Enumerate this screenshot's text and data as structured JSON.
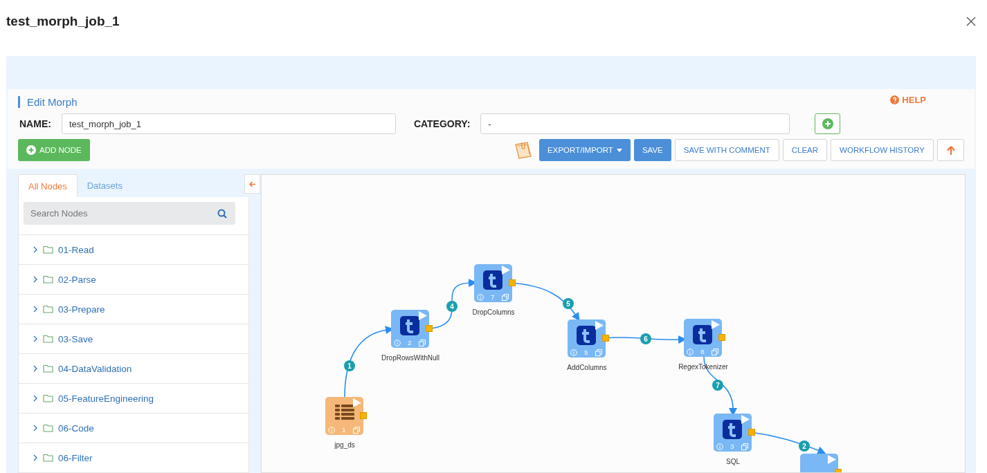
{
  "window": {
    "title": "test_morph_job_1"
  },
  "editor": {
    "heading": "Edit Morph",
    "help": "HELP",
    "name_label": "NAME:",
    "name_value": "test_morph_job_1",
    "category_label": "CATEGORY:",
    "category_value": "-",
    "add_node": "ADD NODE",
    "actions": [
      {
        "label": "EXPORT/IMPORT",
        "kind": "dropdown"
      },
      {
        "label": "SAVE",
        "kind": "primary"
      },
      {
        "label": "SAVE WITH COMMENT",
        "kind": "plain"
      },
      {
        "label": "CLEAR",
        "kind": "plain"
      },
      {
        "label": "WORKFLOW HISTORY",
        "kind": "plain"
      }
    ]
  },
  "sidebar": {
    "tabs": [
      {
        "label": "All Nodes",
        "selected": true
      },
      {
        "label": "Datasets",
        "selected": false
      }
    ],
    "search": {
      "placeholder": "Search Nodes"
    },
    "items": [
      {
        "label": "01-Read",
        "expanded": false
      },
      {
        "label": "02-Parse",
        "expanded": false
      },
      {
        "label": "03-Prepare",
        "expanded": false
      },
      {
        "label": "03-Save",
        "expanded": false
      },
      {
        "label": "04-DataValidation",
        "expanded": false
      },
      {
        "label": "05-FeatureEngineering",
        "expanded": false
      },
      {
        "label": "06-Code",
        "expanded": false
      },
      {
        "label": "06-Filter",
        "expanded": false
      }
    ]
  },
  "canvas": {
    "nodes": [
      {
        "kind": "dataset",
        "label": "jpg_ds",
        "number": "1"
      },
      {
        "kind": "transform",
        "label": "DropRowsWithNull",
        "number": "2"
      },
      {
        "kind": "transform",
        "label": "DropColumns",
        "number": "7"
      },
      {
        "kind": "transform",
        "label": "AddColumns",
        "number": "5"
      },
      {
        "kind": "transform",
        "label": "RegexTokenizer",
        "number": "8"
      },
      {
        "kind": "transform",
        "label": "SQL",
        "number": "3"
      },
      {
        "kind": "transform"
      }
    ],
    "edges": [
      {
        "label": "1"
      },
      {
        "label": "4"
      },
      {
        "label": "5"
      },
      {
        "label": "6"
      },
      {
        "label": "7"
      },
      {
        "label": "2"
      }
    ]
  }
}
